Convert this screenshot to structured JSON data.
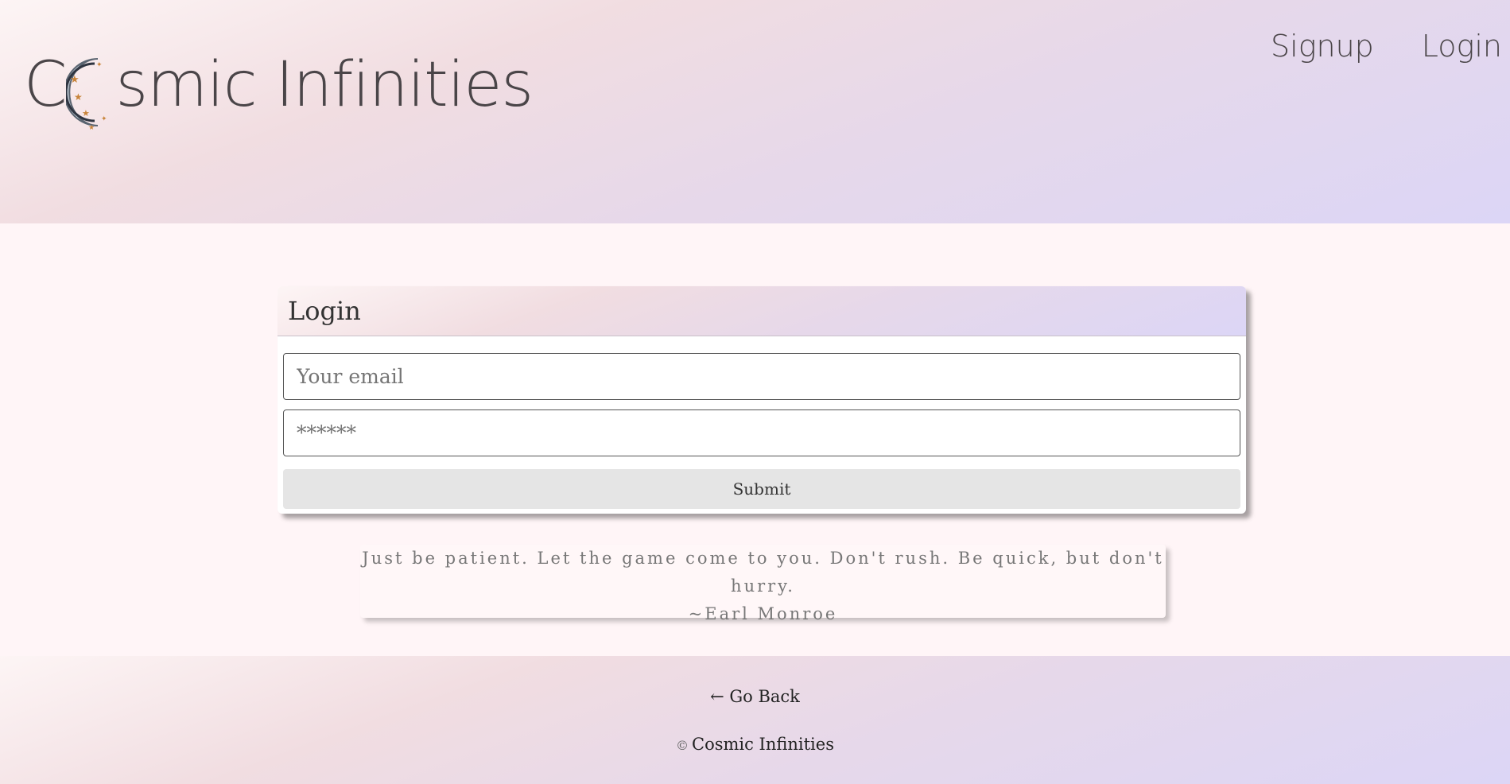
{
  "header": {
    "brand_prefix": "C",
    "brand_suffix": "smic Infinities",
    "nav": {
      "signup": "Signup",
      "login": "Login"
    }
  },
  "login_card": {
    "title": "Login",
    "email_placeholder": "Your email",
    "password_placeholder": "******",
    "submit_label": "Submit"
  },
  "quote": {
    "text": "Just be patient. Let the game come to you. Don't rush. Be quick, but don't hurry.",
    "author": "~Earl Monroe"
  },
  "footer": {
    "go_back": "← Go Back",
    "copyright_symbol": "©",
    "copyright_text": "Cosmic Infinities"
  },
  "colors": {
    "text": "#4a4548",
    "page_background": "#fff5f7",
    "gradient_start": "#fdf5f5",
    "gradient_end": "#dcd6f6"
  }
}
